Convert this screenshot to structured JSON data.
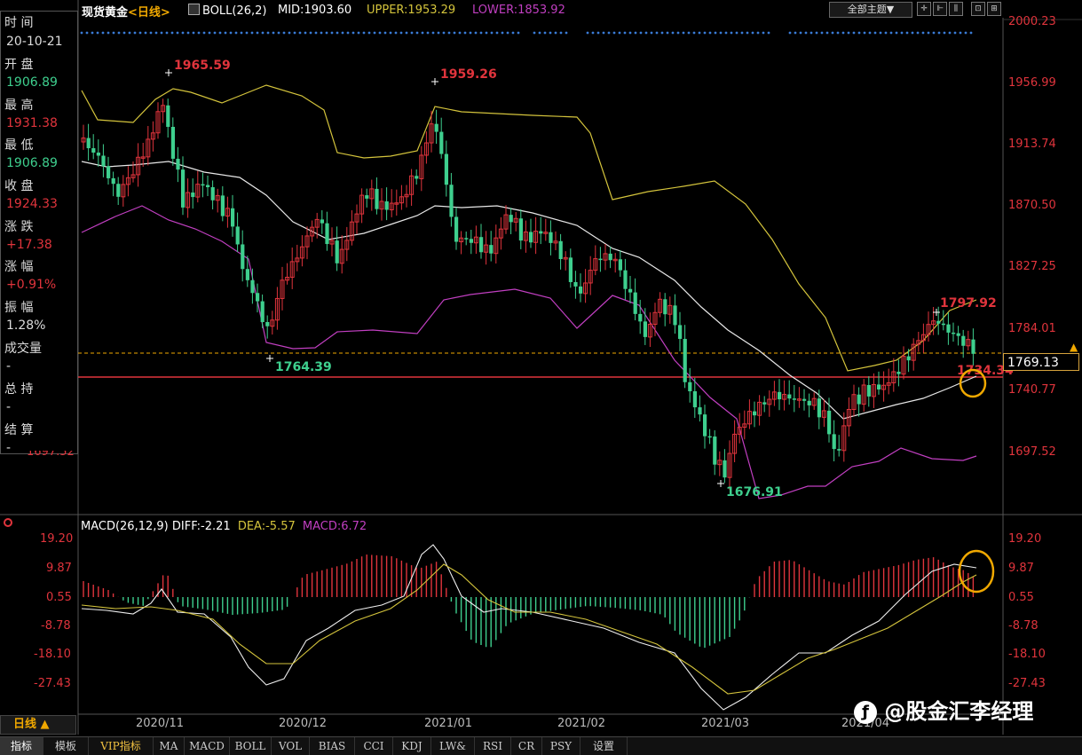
{
  "header": {
    "symbol": "现货黄金",
    "period": "<日线>",
    "indicator": "BOLL(26,2)",
    "mid": "MID:1903.60",
    "upper": "UPPER:1953.29",
    "lower": "LOWER:1853.92",
    "theme_button": "全部主题▼"
  },
  "info_panel": {
    "time_label": "时 间",
    "time_value": "20-10-21",
    "open_label": "开 盘",
    "open_value": "1906.89",
    "high_label": "最 高",
    "high_value": "1931.38",
    "low_label": "最 低",
    "low_value": "1906.89",
    "close_label": "收 盘",
    "close_value": "1924.33",
    "change_label": "涨 跌",
    "change_value": "+17.38",
    "pct_label": "涨 幅",
    "pct_value": "+0.91%",
    "amp_label": "振 幅",
    "amp_value": "1.28%",
    "volume_label": "成交量",
    "volume_value": "-",
    "oi_label": "总 持",
    "oi_value": "-",
    "settle_label": "结 算",
    "settle_value": "-",
    "hidden_axis": "1697.52"
  },
  "price_axis": [
    "2000.23",
    "1956.99",
    "1913.74",
    "1870.50",
    "1827.25",
    "1784.01",
    "1740.77",
    "1697.52"
  ],
  "current_price": "1769.13",
  "annotations": {
    "high1": "1965.59",
    "high2": "1959.26",
    "low1": "1764.39",
    "low2": "1676.91",
    "high3": "1797.92",
    "partial": "1734.34"
  },
  "macd_header": {
    "title": "MACD(26,12,9)",
    "diff": "DIFF:-2.21",
    "dea": "DEA:-5.57",
    "macd": "MACD:6.72"
  },
  "macd_axis": [
    "19.20",
    "9.87",
    "0.55",
    "-8.78",
    "-18.10",
    "-27.43"
  ],
  "dates": [
    "2020/11",
    "2020/12",
    "2021/01",
    "2021/02",
    "2021/03",
    "2021/04"
  ],
  "period_button": "日线 ▲",
  "watermark": "@股金汇李经理",
  "tabs": [
    "指标",
    "模板",
    "VIP指标",
    "MA",
    "MACD",
    "BOLL",
    "VOL",
    "BIAS",
    "CCI",
    "KDJ",
    "LW&",
    "RSI",
    "CR",
    "PSY",
    "设置"
  ],
  "colors": {
    "up": "#e0343c",
    "down": "#3ecf8e",
    "upper_band": "#d4c43c",
    "lower_band": "#c13fc1",
    "mid_band": "#e8e8e8",
    "highlight": "#f0a800"
  }
}
